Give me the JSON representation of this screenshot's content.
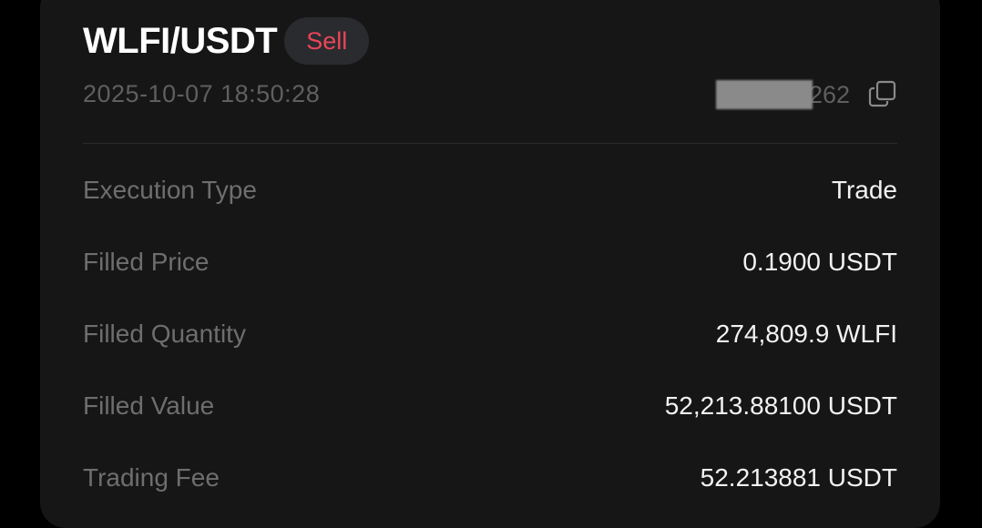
{
  "header": {
    "pair": "WLFI/USDT",
    "side": "Sell",
    "side_color": "#e8455a"
  },
  "meta": {
    "timestamp": "2025-10-07 18:50:28",
    "order_id_suffix": "262",
    "copy_icon": "copy-icon"
  },
  "details": [
    {
      "label": "Execution Type",
      "value": "Trade"
    },
    {
      "label": "Filled Price",
      "value": "0.1900 USDT"
    },
    {
      "label": "Filled Quantity",
      "value": "274,809.9 WLFI"
    },
    {
      "label": "Filled Value",
      "value": "52,213.88100 USDT"
    },
    {
      "label": "Trading Fee",
      "value": "52.213881 USDT"
    }
  ]
}
